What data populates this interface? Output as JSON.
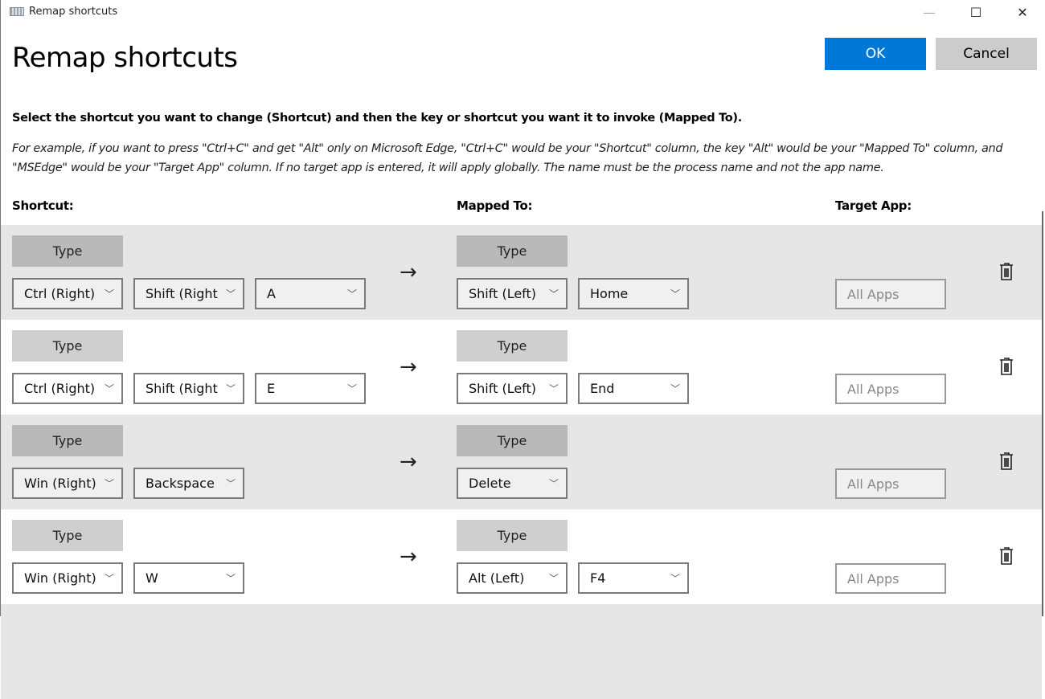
{
  "window": {
    "title": "Remap shortcuts",
    "minimize": "—",
    "maximize": "☐",
    "close": "✕"
  },
  "page_title": "Remap shortcuts",
  "ok_label": "OK",
  "cancel_label": "Cancel",
  "instruction": "Select the shortcut you want to change (Shortcut) and then the key or shortcut you want it to invoke (Mapped To).",
  "example": "For example, if you want to press \"Ctrl+C\" and get \"Alt\" only on Microsoft Edge, \"Ctrl+C\" would be your \"Shortcut\" column, the key \"Alt\" would be your \"Mapped To\" column, and \"MSEdge\" would be your \"Target App\" column. If no target app is entered, it will apply globally. The name must be the process name and not the app name.",
  "headers": {
    "shortcut": "Shortcut:",
    "mapped": "Mapped To:",
    "target": "Target App:"
  },
  "type_label": "Type",
  "arrow": "→",
  "rows": [
    {
      "shortcut": [
        "Ctrl (Right)",
        "Shift (Right)",
        "A"
      ],
      "mapped": [
        "Shift (Left)",
        "Home"
      ],
      "target_placeholder": "All Apps"
    },
    {
      "shortcut": [
        "Ctrl (Right)",
        "Shift (Right)",
        "E"
      ],
      "mapped": [
        "Shift (Left)",
        "End"
      ],
      "target_placeholder": "All Apps"
    },
    {
      "shortcut": [
        "Win (Right)",
        "Backspace"
      ],
      "mapped": [
        "Delete"
      ],
      "target_placeholder": "All Apps"
    },
    {
      "shortcut": [
        "Win (Right)",
        "W"
      ],
      "mapped": [
        "Alt (Left)",
        "F4"
      ],
      "target_placeholder": "All Apps"
    }
  ]
}
